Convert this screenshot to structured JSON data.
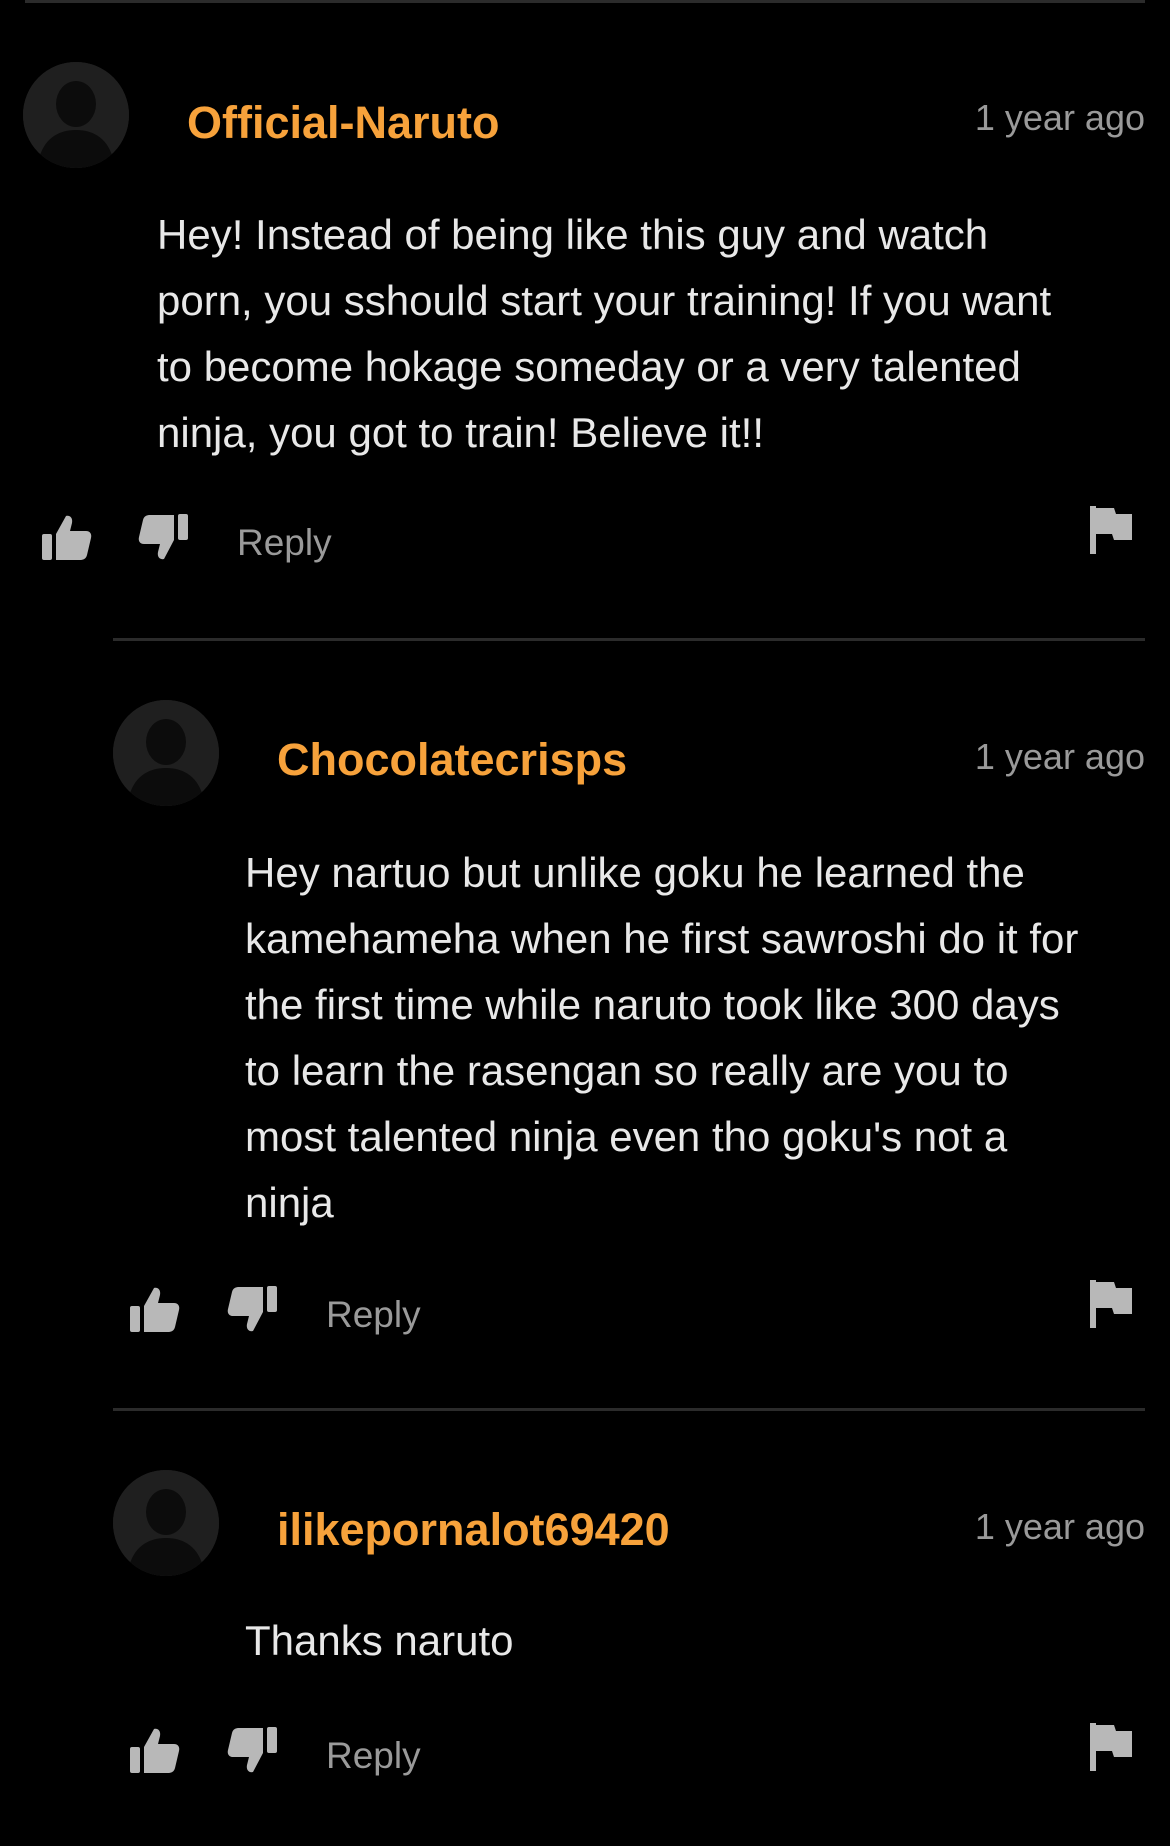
{
  "comments": [
    {
      "username": "Official-Naruto",
      "timestamp": "1 year ago",
      "text": "Hey! Instead of being like this guy and watch\nporn, you sshould start your training! If you want\nto become hokage someday or a very talented\nninja, you got to train! Believe it!!",
      "reply_label": "Reply"
    },
    {
      "username": "Chocolatecrisps",
      "timestamp": "1 year ago",
      "text": "Hey nartuo but unlike goku he learned the\nkamehameha when he first sawroshi do it for\nthe first time while naruto took like 300 days\nto learn the rasengan so really are you to\nmost talented ninja even tho goku's not a\nninja",
      "reply_label": "Reply"
    },
    {
      "username": "ilikepornalot69420",
      "timestamp": "1 year ago",
      "text": "Thanks naruto",
      "reply_label": "Reply"
    }
  ],
  "icons": {
    "like": "thumbs-up-icon",
    "dislike": "thumbs-down-icon",
    "flag": "flag-icon",
    "avatar": "default-avatar-icon"
  },
  "colors": {
    "background": "#000000",
    "username": "#f7a23b",
    "timestamp": "#9a9a9a",
    "body_text": "#e8e8e8",
    "icon": "#b8b8b8",
    "divider": "#2b2b2b"
  }
}
